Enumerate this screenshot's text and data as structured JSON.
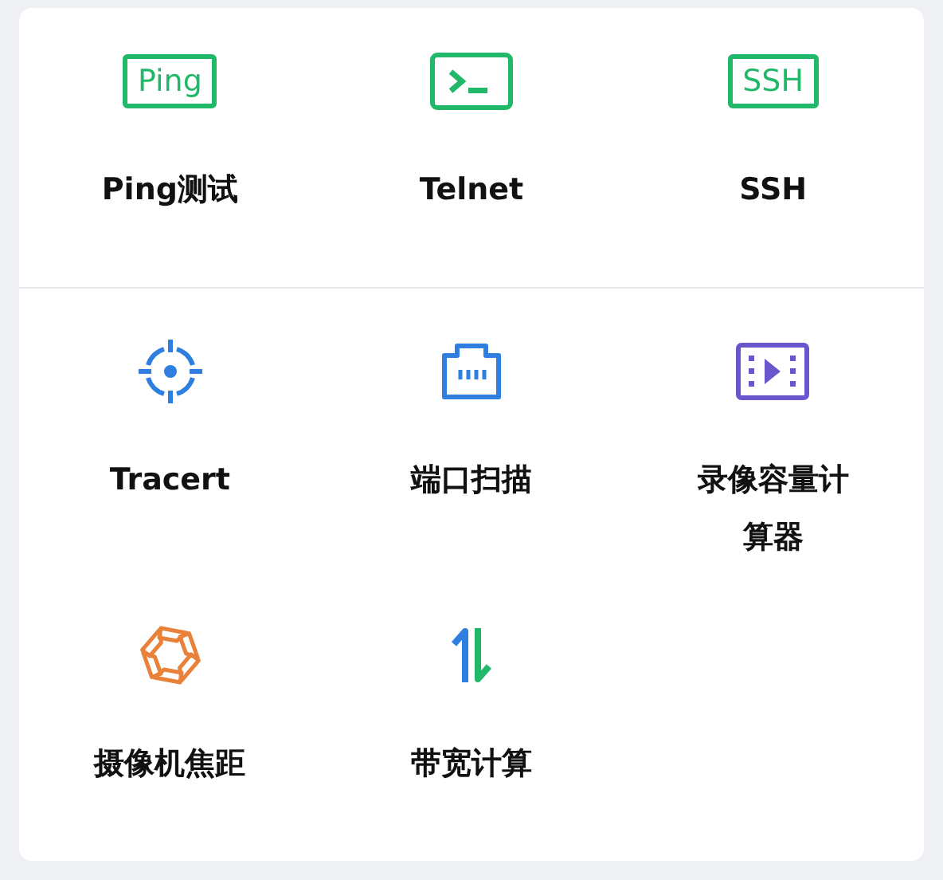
{
  "sections": [
    {
      "items": [
        {
          "label": "Ping测试",
          "kind": "badge",
          "icon_text": "Ping"
        },
        {
          "label": "Telnet",
          "kind": "terminal"
        },
        {
          "label": "SSH",
          "kind": "badge",
          "icon_text": "SSH"
        }
      ]
    },
    {
      "items": [
        {
          "label": "Tracert",
          "kind": "target"
        },
        {
          "label": "端口扫描",
          "kind": "port"
        },
        {
          "label": "录像容量计算器",
          "kind": "video"
        },
        {
          "label": "摄像机焦距",
          "kind": "aperture"
        },
        {
          "label": "带宽计算",
          "kind": "updown"
        }
      ]
    }
  ]
}
